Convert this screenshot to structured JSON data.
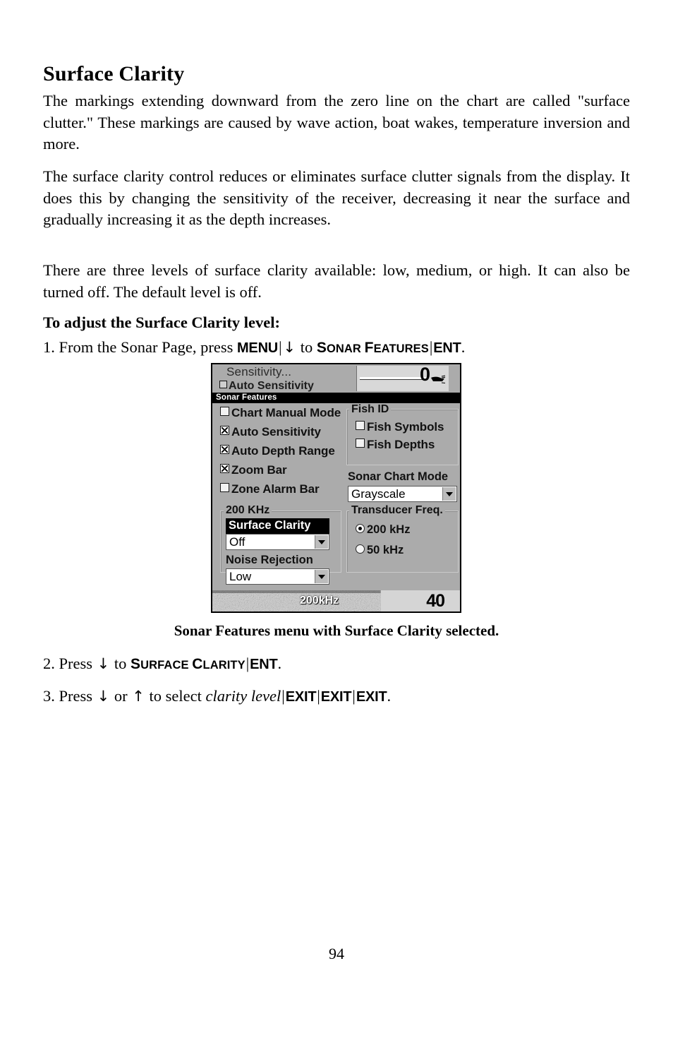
{
  "document": {
    "heading": "Surface Clarity",
    "paragraphs": [
      "The markings extending downward from the zero line on the chart are called \"surface clutter.\" These markings are caused by wave action, boat wakes, temperature inversion and more.",
      "The surface clarity control reduces or eliminates surface clutter signals from the display. It does this by changing the sensitivity of the receiver, decreasing it near the surface and gradually increasing it as the depth increases.",
      "There are three levels of surface clarity available: low, medium, or high. It can also be turned off. The default level is off."
    ],
    "subhead": "To adjust the Surface Clarity level:",
    "steps": {
      "step1": {
        "number": "1.",
        "lead": "From the Sonar Page, press",
        "key1": "MENU",
        "sep": "|",
        "arrow_down": "↓",
        "connector": "to",
        "key2_cap": "S",
        "key2_rest": "ONAR",
        "key3_cap": "F",
        "key3_rest": "EATURES",
        "key4": "ENT",
        "period": "."
      },
      "step2": {
        "number": "2.",
        "lead": "Press",
        "arrow_down": "↓",
        "connector": "to",
        "key1_cap": "S",
        "key1_rest": "URFACE",
        "key2_cap": "C",
        "key2_rest": "LARITY",
        "sep": "|",
        "key3": "ENT",
        "period": "."
      },
      "step3": {
        "number": "3.",
        "lead": "Press",
        "arrow_down": "↓",
        "or": "or",
        "arrow_up": "↑",
        "connector": "to select",
        "italic_value": "clarity level",
        "sep": "|",
        "key1": "EXIT",
        "key2": "EXIT",
        "key3": "EXIT",
        "period": "."
      }
    },
    "figure_caption": "Sonar Features menu with Surface Clarity selected.",
    "page_number": "94"
  },
  "device": {
    "background_color": "#ababab",
    "previous_menu": {
      "title": "Sensitivity...",
      "row2_label": "Auto Sensitivity"
    },
    "depth_indicator": {
      "value": "0",
      "icon": "boat-transducer-icon"
    },
    "titlebar": "Sonar Features",
    "checkboxes": [
      {
        "label": "Chart Manual Mode",
        "checked": false
      },
      {
        "label": "Auto Sensitivity",
        "checked": true
      },
      {
        "label": "Auto Depth Range",
        "checked": true
      },
      {
        "label": "Zoom Bar",
        "checked": true
      },
      {
        "label": "Zone Alarm Bar",
        "checked": false
      }
    ],
    "fish_id": {
      "group_label": "Fish ID",
      "options": [
        {
          "label": "Fish Symbols",
          "checked": false
        },
        {
          "label": "Fish Depths",
          "checked": false
        }
      ]
    },
    "sonar_chart_mode": {
      "label": "Sonar Chart Mode",
      "value": "Grayscale"
    },
    "khz_group": {
      "group_label": "200 KHz",
      "surface_clarity_label": "Surface Clarity",
      "surface_clarity_value": "Off",
      "surface_clarity_selected": true,
      "noise_rejection_label": "Noise Rejection",
      "noise_rejection_value": "Low"
    },
    "transducer_freq": {
      "group_label": "Transducer Freq.",
      "options": [
        {
          "label": "200 kHz",
          "selected": true
        },
        {
          "label": "50 kHz",
          "selected": false
        }
      ]
    },
    "status_strip": {
      "frequency": "200kHz",
      "depth": "40"
    }
  }
}
